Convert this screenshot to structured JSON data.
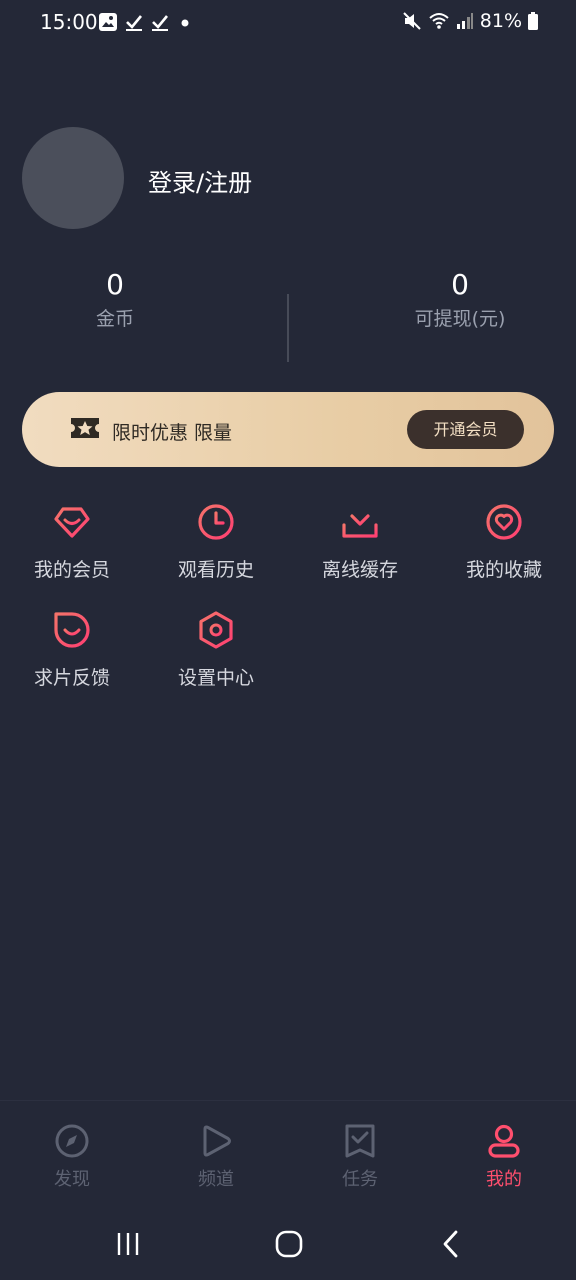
{
  "status_bar": {
    "time": "15:00",
    "battery": "81%",
    "icons": [
      "image-icon",
      "check-icon",
      "check-icon",
      "dot-icon",
      "mute-icon",
      "wifi-icon",
      "signal-icon",
      "battery-icon"
    ]
  },
  "profile": {
    "login_text": "登录/注册"
  },
  "stats": {
    "coins_value": "0",
    "coins_label": "金币",
    "withdraw_value": "0",
    "withdraw_label": "可提现(元)"
  },
  "vip_banner": {
    "text": "限时优惠 限量",
    "button": "开通会员"
  },
  "features": {
    "my_vip": "我的会员",
    "history": "观看历史",
    "offline_cache": "离线缓存",
    "favorites": "我的收藏",
    "feedback": "求片反馈",
    "settings": "设置中心"
  },
  "bottom_nav": {
    "discover": "发现",
    "channel": "频道",
    "tasks": "任务",
    "mine": "我的"
  },
  "colors": {
    "background": "#242837",
    "accent": "#ff4f6e",
    "icon_gradient_start": "#f5736a",
    "icon_gradient_end": "#ff3f72",
    "vip_gold": "#e8cda5"
  }
}
